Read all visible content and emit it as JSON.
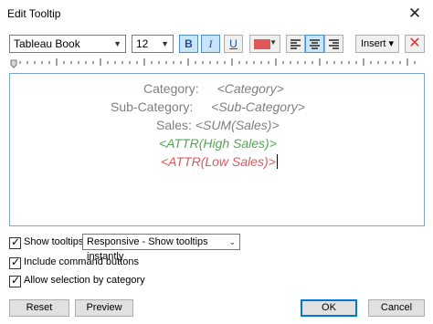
{
  "window": {
    "title": "Edit Tooltip",
    "close_glyph": "✕"
  },
  "toolbar": {
    "font": "Tableau Book",
    "size": "12",
    "bold_label": "B",
    "italic_label": "I",
    "underline_label": "U",
    "text_color": "#e15759",
    "insert_label": "Insert ▾",
    "delete_glyph": "✕"
  },
  "editor": {
    "lines": [
      {
        "label": "Category:",
        "field": "<Category>"
      },
      {
        "label": "Sub-Category:",
        "field": "<Sub-Category>"
      },
      {
        "label": "Sales:",
        "field": "<SUM(Sales)>"
      },
      {
        "field": "<ATTR(High Sales)>",
        "color": "#52a552"
      },
      {
        "field": "<ATTR(Low Sales)>",
        "color": "#e15759"
      }
    ]
  },
  "options": {
    "show_tooltips": {
      "label": "Show tooltips",
      "checked": true
    },
    "tooltip_mode": "Responsive - Show tooltips instantly",
    "include_command_buttons": {
      "label": "Include command buttons",
      "checked": true
    },
    "allow_selection": {
      "label": "Allow selection by category",
      "checked": true
    }
  },
  "buttons": {
    "reset": "Reset",
    "preview": "Preview",
    "ok": "OK",
    "cancel": "Cancel"
  }
}
